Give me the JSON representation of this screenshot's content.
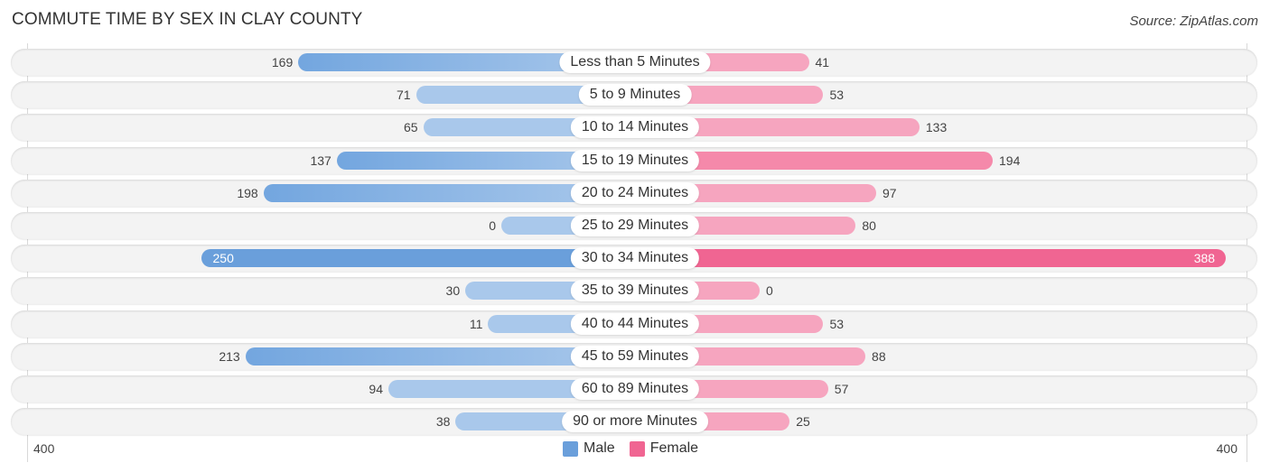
{
  "chart_data": {
    "type": "bar",
    "orientation": "horizontal-diverging",
    "title": "COMMUTE TIME BY SEX IN CLAY COUNTY",
    "source": "Source: ZipAtlas.com",
    "categories": [
      "Less than 5 Minutes",
      "5 to 9 Minutes",
      "10 to 14 Minutes",
      "15 to 19 Minutes",
      "20 to 24 Minutes",
      "25 to 29 Minutes",
      "30 to 34 Minutes",
      "35 to 39 Minutes",
      "40 to 44 Minutes",
      "45 to 59 Minutes",
      "60 to 89 Minutes",
      "90 or more Minutes"
    ],
    "series": [
      {
        "name": "Male",
        "color": "#6a9fdb",
        "light_color": "#a9c8eb",
        "values": [
          169,
          71,
          65,
          137,
          198,
          0,
          250,
          30,
          11,
          213,
          94,
          38
        ]
      },
      {
        "name": "Female",
        "color": "#f06592",
        "light_color": "#f6a5bf",
        "values": [
          41,
          53,
          133,
          194,
          97,
          80,
          388,
          0,
          53,
          88,
          57,
          25
        ]
      }
    ],
    "axis": {
      "left_tick": "400",
      "right_tick": "400",
      "range": [
        -400,
        400
      ]
    },
    "legend": {
      "position": "bottom-center",
      "items": [
        "Male",
        "Female"
      ]
    },
    "grid": false
  }
}
